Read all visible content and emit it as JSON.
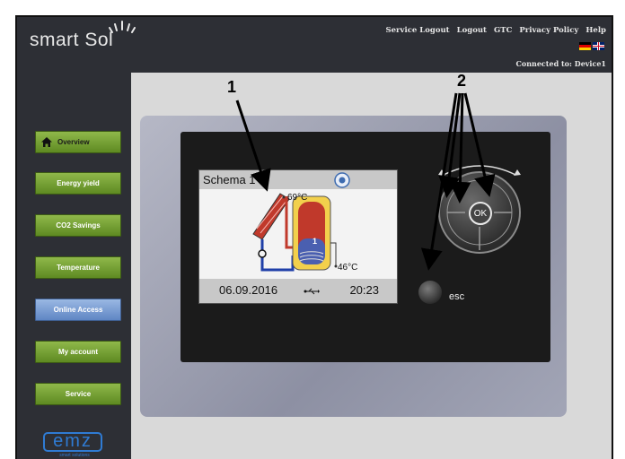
{
  "brand": {
    "logo_text": "smart Sol"
  },
  "toplinks": [
    "Service Logout",
    "Logout",
    "GTC",
    "Privacy Policy",
    "Help"
  ],
  "connection": {
    "label": "Connected to:",
    "device": "Device1"
  },
  "sidebar": {
    "items": [
      {
        "label": "Overview",
        "active": false
      },
      {
        "label": "Energy yield",
        "active": false
      },
      {
        "label": "CO2 Savings",
        "active": false
      },
      {
        "label": "Temperature",
        "active": false
      },
      {
        "label": "Online Access",
        "active": true
      },
      {
        "label": "My account",
        "active": false
      },
      {
        "label": "Service",
        "active": false
      }
    ]
  },
  "footer_logo": {
    "name": "emz",
    "tagline": "smart solutions"
  },
  "device": {
    "screen_title": "Schema 1",
    "temp_collector": "69°C",
    "temp_tank": "46°C",
    "tank_number": "1",
    "date": "06.09.2016",
    "time": "20:23",
    "ok_label": "OK",
    "esc_label": "esc"
  },
  "callouts": [
    "1",
    "2"
  ],
  "colors": {
    "nav_green": "#6f9a30",
    "nav_active_blue": "#6f93cc",
    "dark_bg": "#2d2f35",
    "emz_blue": "#2f7bd3"
  }
}
